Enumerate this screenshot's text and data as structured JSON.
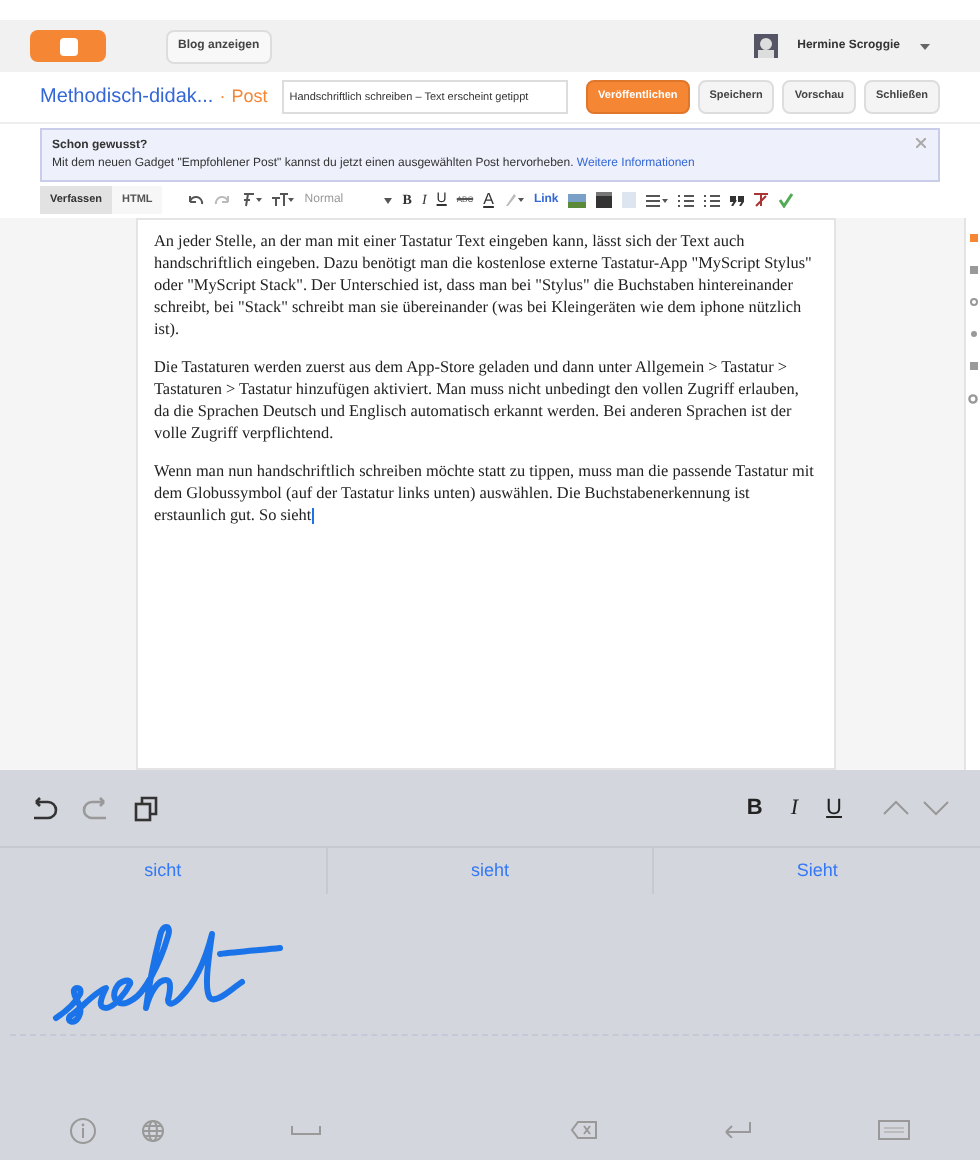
{
  "header": {
    "view_blog_button": "Blog anzeigen",
    "user_name": "Hermine Scroggie"
  },
  "post_bar": {
    "blog_title": "Methodisch-didak...",
    "separator": "·",
    "section": "Post",
    "title_value": "Handschriftlich schreiben – Text erscheint getippt",
    "buttons": [
      {
        "label": "Veröffentlichen",
        "kind": "primary"
      },
      {
        "label": "Speichern",
        "kind": "secondary"
      },
      {
        "label": "Vorschau",
        "kind": "secondary"
      },
      {
        "label": "Schließen",
        "kind": "secondary"
      }
    ]
  },
  "notice": {
    "title": "Schon gewusst?",
    "text": "Mit dem neuen Gadget \"Empfohlener Post\" kannst du jetzt einen ausgewählten Post hervorheben.",
    "link": "Weitere Informationen"
  },
  "toolbar": {
    "tabs": [
      {
        "label": "Verfassen",
        "selected": true
      },
      {
        "label": "HTML",
        "selected": false
      }
    ],
    "format_value": "Normal",
    "text_buttons": [
      {
        "label": "B",
        "kind": "bold"
      },
      {
        "label": "I",
        "kind": "italic"
      },
      {
        "label": "U",
        "kind": "underline"
      },
      {
        "label": "ABC",
        "kind": "strike"
      },
      {
        "label": "A",
        "kind": "color"
      }
    ],
    "link": "Link"
  },
  "editor": {
    "paragraphs": [
      "An jeder Stelle, an der man mit einer Tastatur Text eingeben kann, lässt sich der Text auch handschriftlich eingeben. Dazu benötigt man die kostenlose externe Tastatur-App \"MyScript Stylus\" oder \"MyScript Stack\". Der Unterschied ist, dass man bei \"Stylus\" die Buchstaben hintereinander schreibt, bei \"Stack\" schreibt man sie übereinander (was bei Kleingeräten wie dem iphone nützlich ist).",
      "Die Tastaturen werden zuerst aus dem App-Store geladen und dann unter Allgemein > Tastatur > Tastaturen > Tastatur hinzufügen aktiviert. Man muss nicht unbedingt den vollen Zugriff erlauben, da die Sprachen Deutsch und Englisch automatisch erkannt werden. Bei anderen Sprachen ist der volle Zugriff verpflichtend.",
      "Wenn man nun handschriftlich schreiben möchte statt zu tippen, muss man die passende Tastatur mit dem Globussymbol (auf der Tastatur links unten) auswählen. Die Buchstabenerkennung ist erstaunlich gut. So sieht"
    ]
  },
  "keyboard": {
    "format_buttons": [
      "B",
      "I",
      "U"
    ],
    "suggestions": [
      "sicht",
      "sieht",
      "Sieht"
    ]
  }
}
